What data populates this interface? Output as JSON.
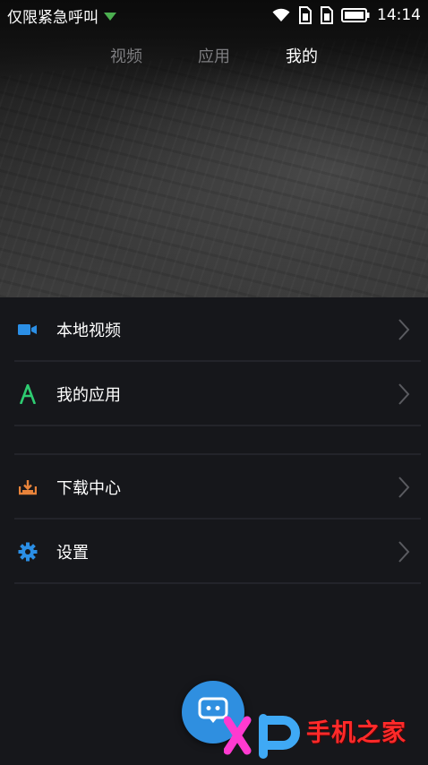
{
  "status_bar": {
    "carrier": "仅限紧急呼叫",
    "time": "14:14",
    "icons": [
      "wifi-icon",
      "sim-card-1-icon",
      "sim-card-2-icon",
      "battery-icon"
    ]
  },
  "tabs": [
    {
      "label": "视频",
      "active": false
    },
    {
      "label": "应用",
      "active": false
    },
    {
      "label": "我的",
      "active": true
    }
  ],
  "menu": {
    "group1": [
      {
        "label": "本地视频",
        "icon": "local-video-icon",
        "icon_color": "#2b8fe6"
      },
      {
        "label": "我的应用",
        "icon": "my-apps-icon",
        "icon_color": "#2ecc71"
      }
    ],
    "group2": [
      {
        "label": "下载中心",
        "icon": "download-tray-icon",
        "icon_color": "#e8833a"
      },
      {
        "label": "设置",
        "icon": "gear-icon",
        "icon_color": "#2b8fe6"
      }
    ]
  },
  "fab": {
    "icon": "chat-robot-icon"
  },
  "watermark": {
    "text": "手机之家",
    "logo": "XP"
  },
  "colors": {
    "background": "#16171b",
    "accent": "#2f8fe0",
    "tab_inactive": "#7d7d80",
    "watermark": "#ff2a2a"
  }
}
